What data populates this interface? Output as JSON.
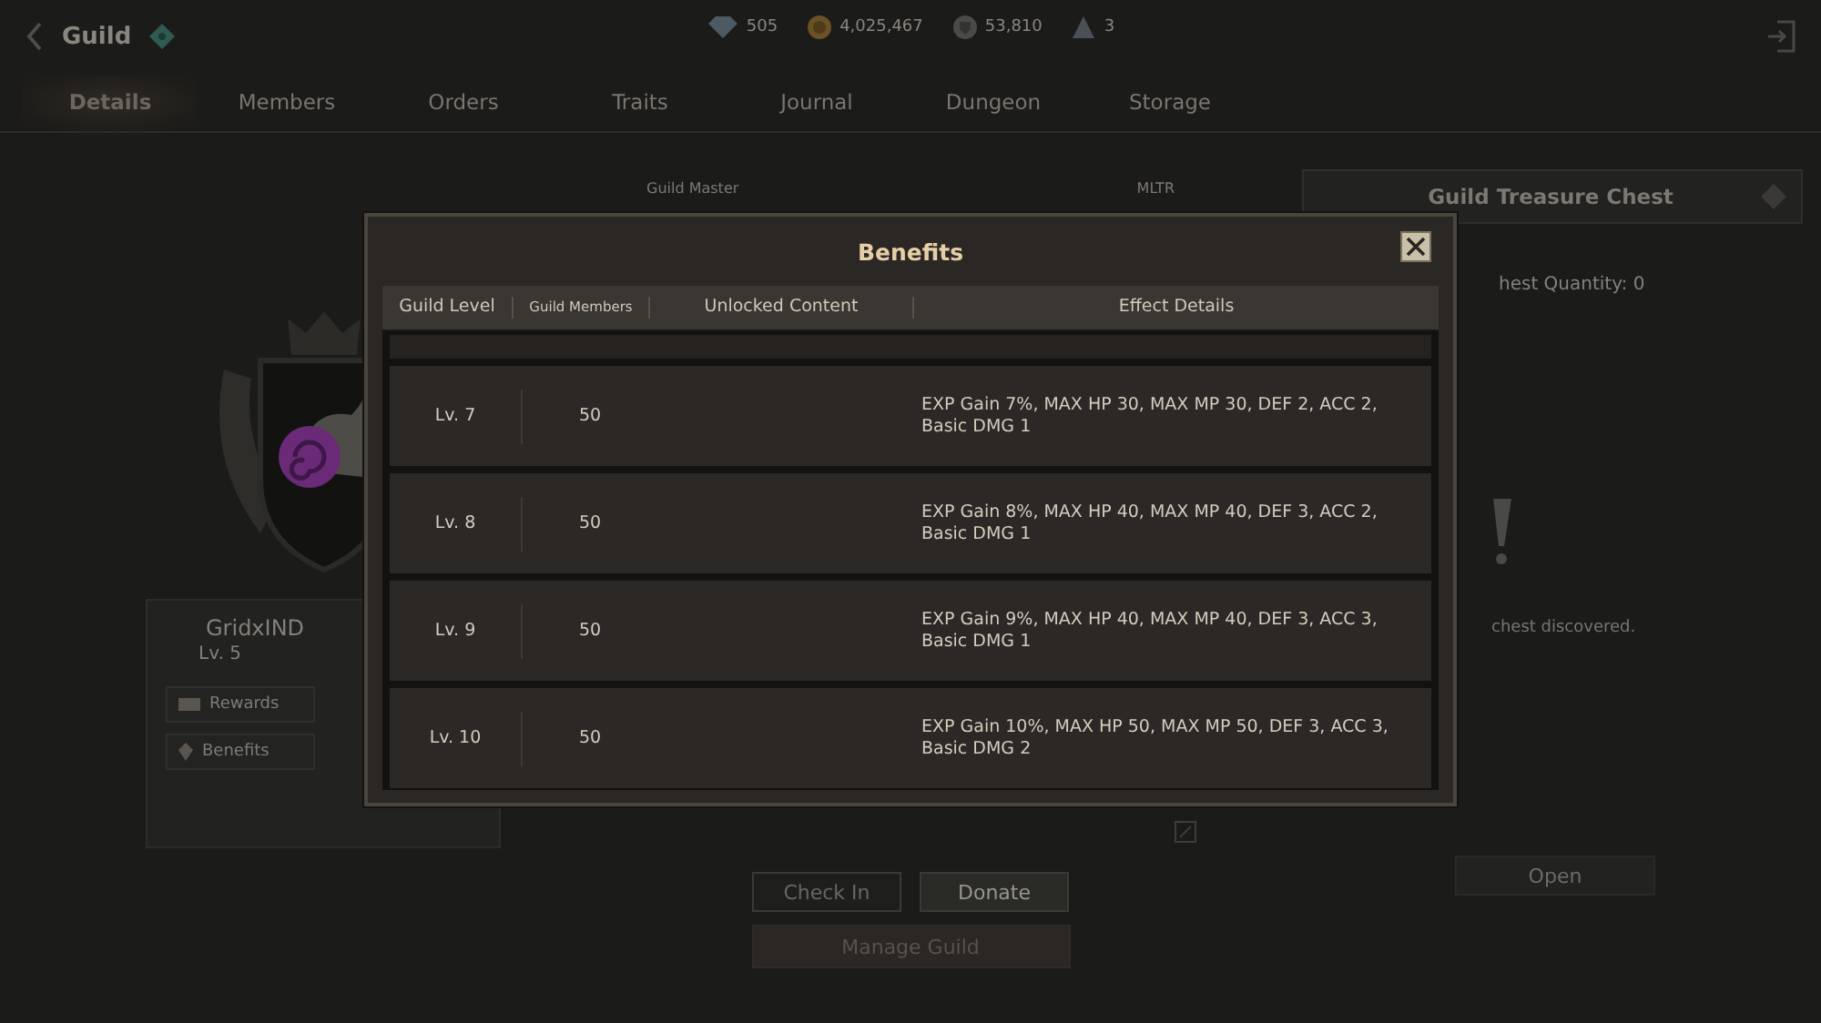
{
  "header": {
    "title": "Guild",
    "currencies": [
      {
        "kind": "gem",
        "amount": "505"
      },
      {
        "kind": "gold",
        "amount": "4,025,467"
      },
      {
        "kind": "token",
        "amount": "53,810"
      },
      {
        "kind": "ticket",
        "amount": "3"
      }
    ]
  },
  "tabs": [
    {
      "label": "Details",
      "selected": true
    },
    {
      "label": "Members",
      "selected": false
    },
    {
      "label": "Orders",
      "selected": false
    },
    {
      "label": "Traits",
      "selected": false
    },
    {
      "label": "Journal",
      "selected": false
    },
    {
      "label": "Dungeon",
      "selected": false
    },
    {
      "label": "Storage",
      "selected": false
    }
  ],
  "guild_card": {
    "name": "GridxIND",
    "level": "Lv. 5",
    "buttons": [
      {
        "kind": "rewards",
        "label": "Rewards"
      },
      {
        "kind": "benefits",
        "label": "Benefits"
      }
    ]
  },
  "info": {
    "label": "Guild Master",
    "value": "MLTR"
  },
  "actions": [
    {
      "label": "Check In",
      "disabled": true
    },
    {
      "label": "Donate",
      "disabled": false
    }
  ],
  "manage_button": "Manage Guild",
  "treasure": {
    "title": "Guild Treasure Chest",
    "quantity": "hest Quantity: 0",
    "message": "chest discovered.",
    "button": "Open"
  },
  "dialog": {
    "title": "Benefits",
    "columns": [
      "Guild Level",
      "Guild Members",
      "Unlocked Content",
      "Effect Details"
    ],
    "rows": [
      {
        "level": "Lv. 7",
        "members": "50",
        "effect": "EXP Gain 7%, MAX HP 30, MAX MP 30, DEF 2, ACC 2, Basic DMG 1"
      },
      {
        "level": "Lv. 8",
        "members": "50",
        "effect": "EXP Gain 8%, MAX HP 40, MAX MP 40, DEF 3, ACC 2, Basic DMG 1"
      },
      {
        "level": "Lv. 9",
        "members": "50",
        "effect": "EXP Gain 9%, MAX HP 40, MAX MP 40, DEF 3, ACC 3, Basic DMG 1"
      },
      {
        "level": "Lv. 10",
        "members": "50",
        "effect": "EXP Gain 10%, MAX HP 50, MAX MP 50, DEF 3, ACC 3, Basic DMG 2"
      }
    ]
  }
}
